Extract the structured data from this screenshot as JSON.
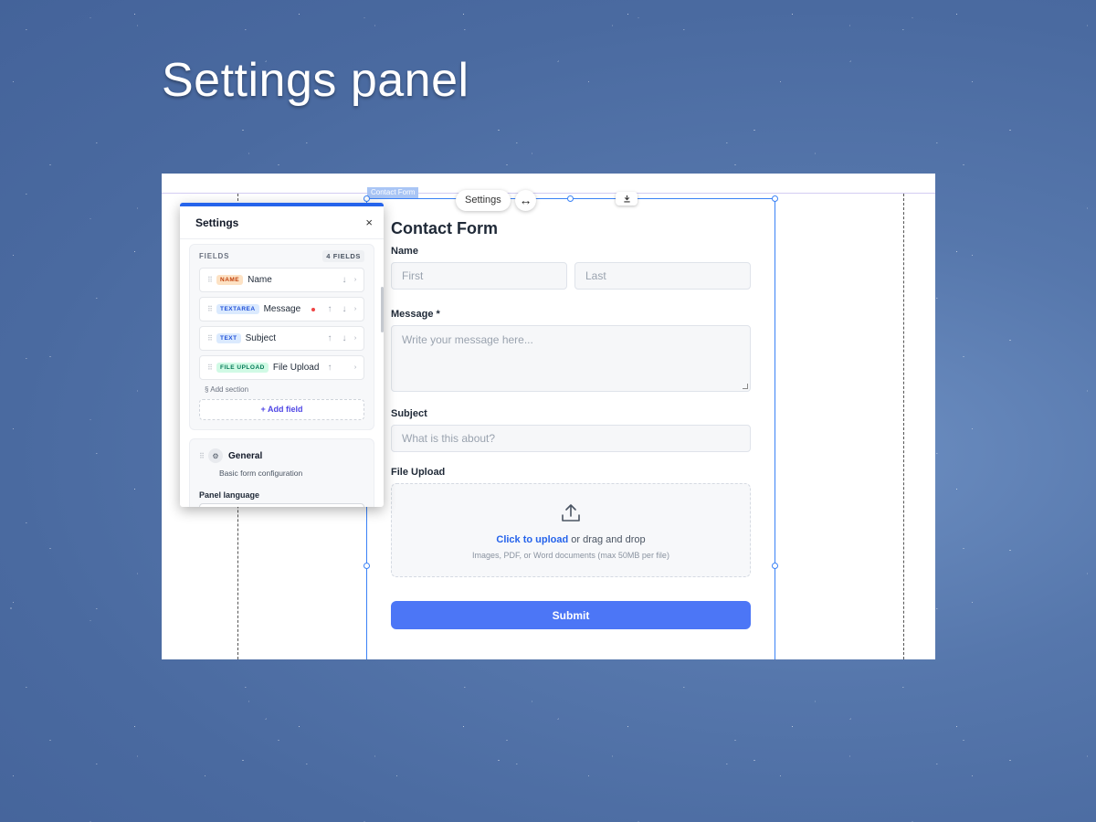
{
  "slide": {
    "title": "Settings panel"
  },
  "canvas": {
    "ghost_label": "Contact Form",
    "toolbar": {
      "settings_label": "Settings",
      "resize_icon": "↔"
    }
  },
  "form": {
    "title": "Contact Form",
    "name": {
      "label": "Name",
      "first_placeholder": "First",
      "last_placeholder": "Last"
    },
    "message": {
      "label": "Message *",
      "placeholder": "Write your message here..."
    },
    "subject": {
      "label": "Subject",
      "placeholder": "What is this about?"
    },
    "upload": {
      "label": "File Upload",
      "link_text": "Click to upload",
      "rest_text": " or drag and drop",
      "hint": "Images, PDF, or Word documents (max 50MB per file)"
    },
    "submit_label": "Submit"
  },
  "panel": {
    "title": "Settings",
    "close_icon": "×",
    "fields_caption": "FIELDS",
    "fields_count": "4 FIELDS",
    "fields": [
      {
        "tag": "NAME",
        "name": "Name",
        "tag_bg": "#fde2c4",
        "tag_color": "#c2410c",
        "required": false,
        "up": false,
        "down": true
      },
      {
        "tag": "TEXTAREA",
        "name": "Message",
        "tag_bg": "#dbeafe",
        "tag_color": "#1d4ed8",
        "required": true,
        "up": true,
        "down": true
      },
      {
        "tag": "TEXT",
        "name": "Subject",
        "tag_bg": "#dbeafe",
        "tag_color": "#1d4ed8",
        "required": false,
        "up": true,
        "down": true
      },
      {
        "tag": "FILE UPLOAD",
        "name": "File Upload",
        "tag_bg": "#d1fae5",
        "tag_color": "#047857",
        "required": false,
        "up": true,
        "down": false
      }
    ],
    "add_section": "§ Add section",
    "add_field": "+ Add field",
    "general": {
      "title": "General",
      "description": "Basic form configuration",
      "icon": "gear-icon"
    },
    "panel_language_label": "Panel language"
  },
  "colors": {
    "accent": "#4c76f6",
    "selection": "#3b82f6",
    "panel_accent": "#2563eb"
  }
}
